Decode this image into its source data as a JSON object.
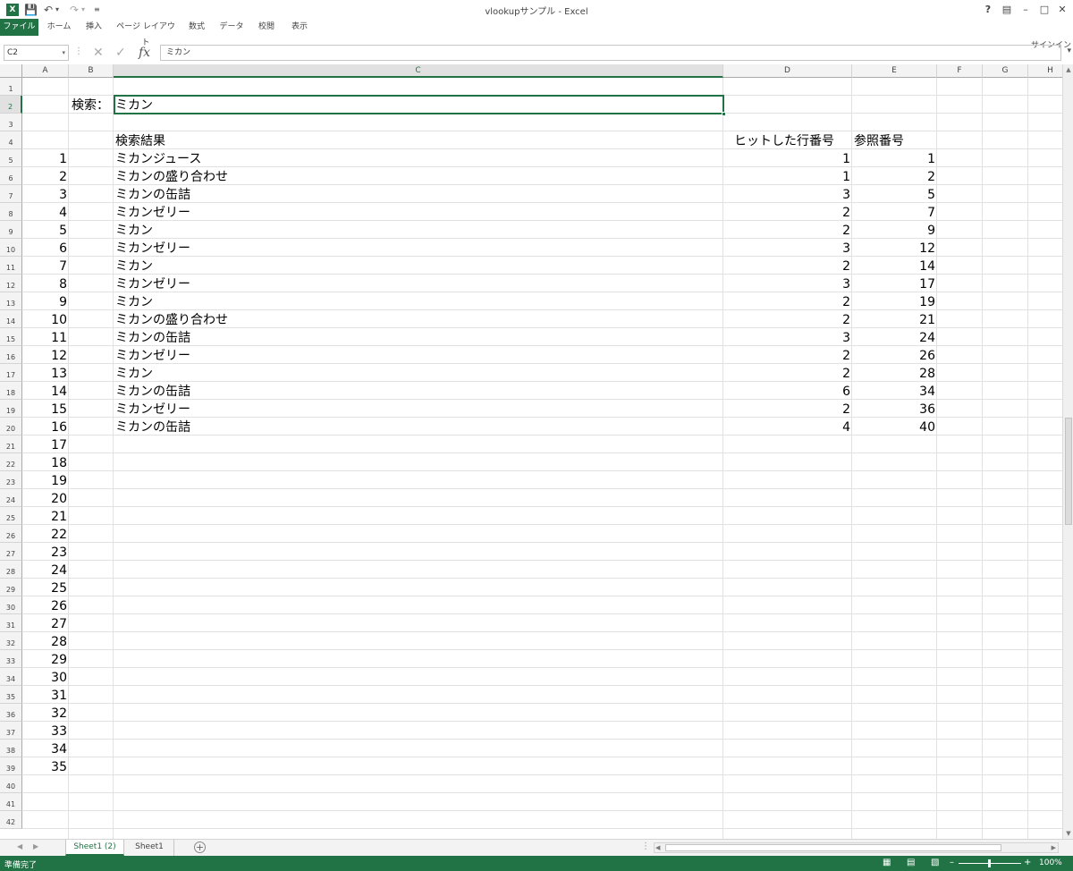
{
  "window": {
    "title": "vlookupサンプル - Excel",
    "app_icon": "X"
  },
  "qat": {
    "save_icon": "save-icon",
    "undo_icon": "undo-icon",
    "redo_icon": "redo-icon",
    "more_icon": "customize-icon"
  },
  "window_controls": {
    "help": "?",
    "ribbon_display": "ribbon-display-icon",
    "minimize": "minimize-icon",
    "restore": "restore-icon",
    "close": "close-icon"
  },
  "ribbon_tabs": [
    "ファイル",
    "ホーム",
    "挿入",
    "ページ レイアウト",
    "数式",
    "データ",
    "校閲",
    "表示"
  ],
  "signin": "サインイン",
  "formula_bar": {
    "name_box": "C2",
    "formula": "ミカン",
    "fx": "fx"
  },
  "columns": [
    "A",
    "B",
    "C",
    "D",
    "E",
    "F",
    "G",
    "H"
  ],
  "rows": [
    "1",
    "2",
    "3",
    "4",
    "5",
    "6",
    "7",
    "8",
    "9",
    "10",
    "11",
    "12",
    "13",
    "14",
    "15",
    "16",
    "17",
    "18",
    "19",
    "20",
    "21",
    "22",
    "23",
    "24",
    "25",
    "26",
    "27",
    "28",
    "29",
    "30",
    "31",
    "32",
    "33",
    "34",
    "35",
    "36",
    "37",
    "38",
    "39",
    "40",
    "41",
    "42"
  ],
  "cells": {
    "search_label": "検索：",
    "search_value": "ミカン",
    "header_result": "検索結果",
    "header_hit_row": "ヒットした行番号",
    "header_ref": "参照番号"
  },
  "results": [
    {
      "n": "1",
      "name": "ミカンジュース",
      "hit": "1",
      "ref": "1"
    },
    {
      "n": "2",
      "name": "ミカンの盛り合わせ",
      "hit": "1",
      "ref": "2"
    },
    {
      "n": "3",
      "name": "ミカンの缶詰",
      "hit": "3",
      "ref": "5"
    },
    {
      "n": "4",
      "name": "ミカンゼリー",
      "hit": "2",
      "ref": "7"
    },
    {
      "n": "5",
      "name": "ミカン",
      "hit": "2",
      "ref": "9"
    },
    {
      "n": "6",
      "name": "ミカンゼリー",
      "hit": "3",
      "ref": "12"
    },
    {
      "n": "7",
      "name": "ミカン",
      "hit": "2",
      "ref": "14"
    },
    {
      "n": "8",
      "name": "ミカンゼリー",
      "hit": "3",
      "ref": "17"
    },
    {
      "n": "9",
      "name": "ミカン",
      "hit": "2",
      "ref": "19"
    },
    {
      "n": "10",
      "name": "ミカンの盛り合わせ",
      "hit": "2",
      "ref": "21"
    },
    {
      "n": "11",
      "name": "ミカンの缶詰",
      "hit": "3",
      "ref": "24"
    },
    {
      "n": "12",
      "name": "ミカンゼリー",
      "hit": "2",
      "ref": "26"
    },
    {
      "n": "13",
      "name": "ミカン",
      "hit": "2",
      "ref": "28"
    },
    {
      "n": "14",
      "name": "ミカンの缶詰",
      "hit": "6",
      "ref": "34"
    },
    {
      "n": "15",
      "name": "ミカンゼリー",
      "hit": "2",
      "ref": "36"
    },
    {
      "n": "16",
      "name": "ミカンの缶詰",
      "hit": "4",
      "ref": "40"
    }
  ],
  "extra_numbers": [
    "17",
    "18",
    "19",
    "20",
    "21",
    "22",
    "23",
    "24",
    "25",
    "26",
    "27",
    "28",
    "29",
    "30",
    "31",
    "32",
    "33",
    "34",
    "35"
  ],
  "sheets": [
    {
      "name": "Sheet1 (2)",
      "active": true
    },
    {
      "name": "Sheet1",
      "active": false
    }
  ],
  "status": {
    "text": "準備完了",
    "zoom": "100%",
    "zoom_level_fraction": 0.5
  },
  "colors": {
    "accent": "#217346"
  }
}
